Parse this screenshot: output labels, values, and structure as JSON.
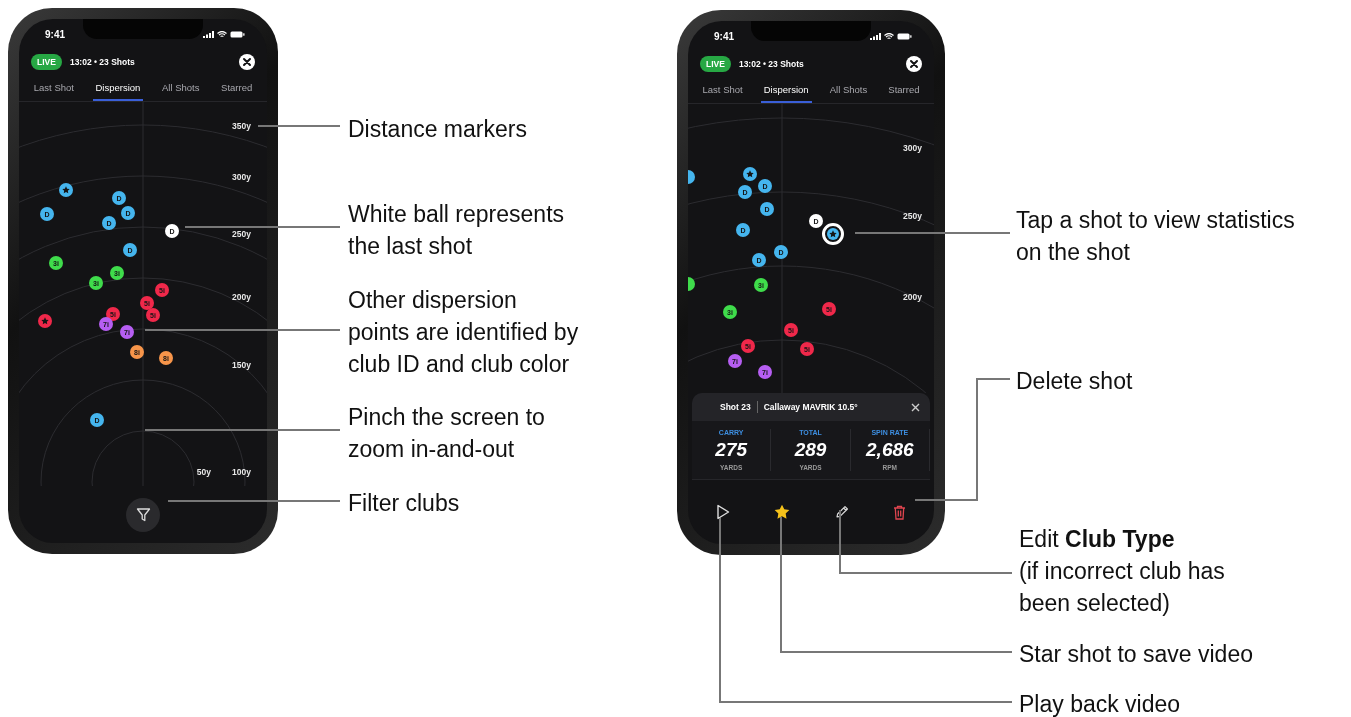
{
  "phones": [
    {
      "status_time": "9:41",
      "badge": "LIVE",
      "session": "13:02 • 23 Shots",
      "tabs": [
        {
          "label": "Last Shot",
          "selected": false
        },
        {
          "label": "Dispersion",
          "selected": true
        },
        {
          "label": "All Shots",
          "selected": false
        },
        {
          "label": "Starred",
          "selected": false
        }
      ],
      "distance_labels": [
        "350y",
        "300y",
        "250y",
        "200y",
        "150y",
        "50y",
        "100y"
      ],
      "shots": [
        {
          "kind": "star",
          "color": "#45b5ee",
          "selected": false
        },
        {
          "kind": "club",
          "label": "D",
          "color": "#45b5ee",
          "selected": false
        },
        {
          "kind": "club",
          "label": "D",
          "color": "#45b5ee",
          "selected": false
        },
        {
          "kind": "club",
          "label": "D",
          "color": "#45b5ee",
          "selected": false
        },
        {
          "kind": "club",
          "label": "D",
          "color": "#45b5ee",
          "selected": false
        },
        {
          "kind": "club",
          "label": "D",
          "color": "#ffffff",
          "selected": false
        },
        {
          "kind": "club",
          "label": "D",
          "color": "#45b5ee",
          "selected": false
        },
        {
          "kind": "club",
          "label": "3i",
          "color": "#3fdc4b",
          "selected": false
        },
        {
          "kind": "club",
          "label": "3i",
          "color": "#3fdc4b",
          "selected": false
        },
        {
          "kind": "club",
          "label": "3i",
          "color": "#3fdc4b",
          "selected": false
        },
        {
          "kind": "club",
          "label": "5i",
          "color": "#f0284a",
          "selected": false
        },
        {
          "kind": "club",
          "label": "5i",
          "color": "#f0284a",
          "selected": false
        },
        {
          "kind": "club",
          "label": "5i",
          "color": "#f0284a",
          "selected": false
        },
        {
          "kind": "club",
          "label": "5i",
          "color": "#f0284a",
          "selected": false
        },
        {
          "kind": "star",
          "color": "#f0284a",
          "selected": false
        },
        {
          "kind": "club",
          "label": "7i",
          "color": "#b65ef2",
          "selected": false
        },
        {
          "kind": "club",
          "label": "7i",
          "color": "#b65ef2",
          "selected": false
        },
        {
          "kind": "club",
          "label": "8i",
          "color": "#f7954a",
          "selected": false
        },
        {
          "kind": "club",
          "label": "8i",
          "color": "#f7954a",
          "selected": false
        },
        {
          "kind": "club",
          "label": "D",
          "color": "#45b5ee",
          "selected": false
        }
      ]
    },
    {
      "status_time": "9:41",
      "badge": "LIVE",
      "session": "13:02 • 23 Shots",
      "tabs": [
        {
          "label": "Last Shot",
          "selected": false
        },
        {
          "label": "Dispersion",
          "selected": true
        },
        {
          "label": "All Shots",
          "selected": false
        },
        {
          "label": "Starred",
          "selected": false
        }
      ],
      "distance_labels": [
        "300y",
        "250y",
        "200y"
      ],
      "shots": [
        {
          "kind": "partial",
          "color": "#45b5ee",
          "selected": false
        },
        {
          "kind": "star",
          "color": "#45b5ee",
          "selected": false
        },
        {
          "kind": "club",
          "label": "D",
          "color": "#45b5ee",
          "selected": false
        },
        {
          "kind": "club",
          "label": "D",
          "color": "#45b5ee",
          "selected": false
        },
        {
          "kind": "club",
          "label": "D",
          "color": "#45b5ee",
          "selected": false
        },
        {
          "kind": "club",
          "label": "D",
          "color": "#ffffff",
          "selected": false
        },
        {
          "kind": "club",
          "label": "D",
          "color": "#45b5ee",
          "selected": false
        },
        {
          "kind": "star",
          "color": "#45b5ee",
          "selected": true
        },
        {
          "kind": "club",
          "label": "D",
          "color": "#45b5ee",
          "selected": false
        },
        {
          "kind": "club",
          "label": "D",
          "color": "#45b5ee",
          "selected": false
        },
        {
          "kind": "partial",
          "color": "#3fdc4b",
          "selected": false
        },
        {
          "kind": "club",
          "label": "3i",
          "color": "#3fdc4b",
          "selected": false
        },
        {
          "kind": "club",
          "label": "3i",
          "color": "#3fdc4b",
          "selected": false
        },
        {
          "kind": "club",
          "label": "5i",
          "color": "#f0284a",
          "selected": false
        },
        {
          "kind": "club",
          "label": "5i",
          "color": "#f0284a",
          "selected": false
        },
        {
          "kind": "club",
          "label": "5i",
          "color": "#f0284a",
          "selected": false
        },
        {
          "kind": "club",
          "label": "5i",
          "color": "#f0284a",
          "selected": false
        },
        {
          "kind": "club",
          "label": "7i",
          "color": "#b65ef2",
          "selected": false
        },
        {
          "kind": "club",
          "label": "7i",
          "color": "#b65ef2",
          "selected": false
        }
      ],
      "shot_card": {
        "title": "Shot 23",
        "club": "Callaway MAVRIK 10.5°",
        "stats": [
          {
            "label": "CARRY",
            "value": "275",
            "unit": "YARDS"
          },
          {
            "label": "TOTAL",
            "value": "289",
            "unit": "YARDS"
          },
          {
            "label": "SPIN RATE",
            "value": "2,686",
            "unit": "RPM"
          }
        ]
      },
      "actions": [
        {
          "kind": "play"
        },
        {
          "kind": "star"
        },
        {
          "kind": "edit"
        },
        {
          "kind": "delete"
        }
      ]
    }
  ],
  "callouts": [
    {
      "lines": [
        "Distance markers"
      ]
    },
    {
      "lines": [
        "White ball represents",
        "the last shot"
      ]
    },
    {
      "lines": [
        "Other dispersion",
        "points are identified by",
        "club ID and club color"
      ]
    },
    {
      "lines": [
        "Pinch the screen to",
        "zoom in-and-out"
      ]
    },
    {
      "lines": [
        "Filter clubs"
      ]
    },
    {
      "lines": [
        "Tap a shot to view statistics",
        "on the shot"
      ]
    },
    {
      "lines": [
        "Delete shot"
      ]
    },
    {
      "lines": [
        "Edit **Club Type**",
        "(if incorrect club has",
        "been selected)"
      ]
    },
    {
      "lines": [
        "Star shot to save video"
      ]
    },
    {
      "lines": [
        "Play back video"
      ]
    }
  ]
}
